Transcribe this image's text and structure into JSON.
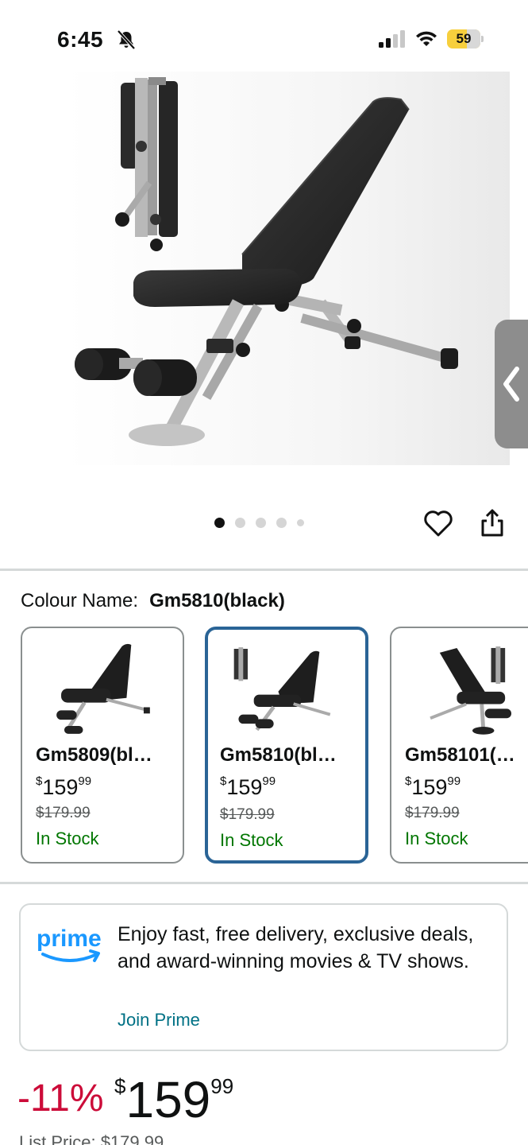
{
  "status_bar": {
    "time": "6:45",
    "battery": "59",
    "battery_level": 0.59
  },
  "gallery": {
    "dots_total": 5,
    "active_dot": 0
  },
  "colour": {
    "label": "Colour Name:",
    "value": "Gm5810(black)"
  },
  "variants": [
    {
      "name": "Gm5809(bl…",
      "currency": "$",
      "price": "159",
      "cents": "99",
      "list_price": "$179.99",
      "stock": "In Stock",
      "selected": false
    },
    {
      "name": "Gm5810(bl…",
      "currency": "$",
      "price": "159",
      "cents": "99",
      "list_price": "$179.99",
      "stock": "In Stock",
      "selected": true
    },
    {
      "name": "Gm58101(…",
      "currency": "$",
      "price": "159",
      "cents": "99",
      "list_price": "$179.99",
      "stock": "In Stock",
      "selected": false
    }
  ],
  "prime": {
    "logo_text": "prime",
    "message": "Enjoy fast, free delivery, exclusive deals, and award-winning movies & TV shows.",
    "link": "Join Prime"
  },
  "price": {
    "discount": "-11%",
    "currency": "$",
    "whole": "159",
    "cents": "99",
    "list_price": "List Price: $179.99"
  },
  "colors": {
    "link": "#007185",
    "deal_red": "#cc0c39",
    "in_stock": "#007600",
    "selected_border": "#2a6496",
    "prime_blue": "#1a98ff",
    "battery_yellow": "#f7cf3d"
  }
}
